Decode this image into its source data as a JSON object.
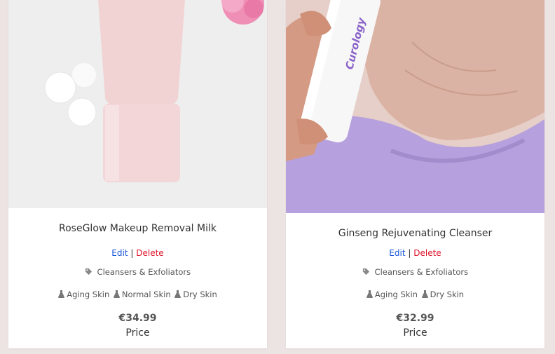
{
  "products": [
    {
      "name": "RoseGlow Makeup Removal Milk",
      "edit_label": "Edit",
      "separator": "|",
      "delete_label": "Delete",
      "category": "Cleansers & Exfoliators",
      "skin_types": [
        "Aging Skin",
        "Normal Skin",
        "Dry Skin"
      ],
      "price": "€34.99",
      "price_label": "Price"
    },
    {
      "name": "Ginseng Rejuvenating Cleanser",
      "edit_label": "Edit",
      "separator": "|",
      "delete_label": "Delete",
      "category": "Cleansers & Exfoliators",
      "skin_types": [
        "Aging Skin",
        "Dry Skin"
      ],
      "price": "€32.99",
      "price_label": "Price",
      "image_text": "Curology"
    }
  ],
  "icons": {
    "category": "tag-icon",
    "skin_type": "flask-icon"
  },
  "colors": {
    "edit": "#1a56db",
    "delete": "#e0162b"
  }
}
